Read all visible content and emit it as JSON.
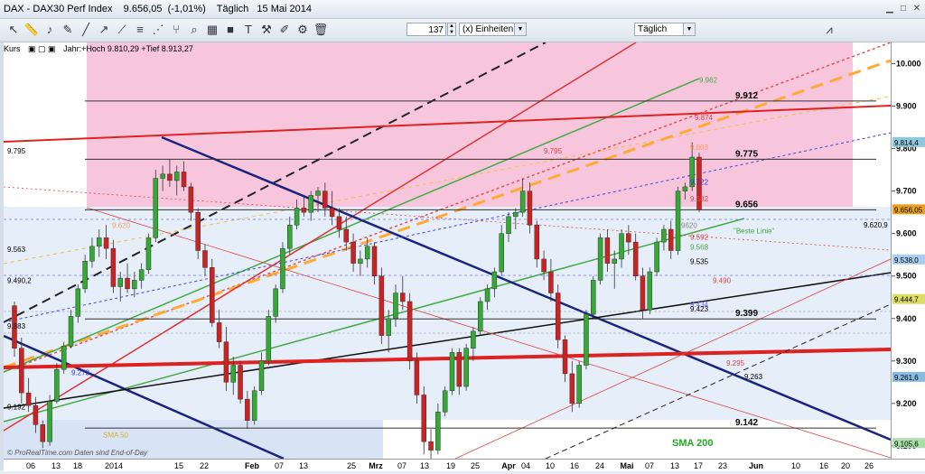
{
  "window": {
    "title": "DAX - DAX30 Perf Index    9.656,05  (-1,01%)    Täglich   15 Mai 2014"
  },
  "toolbar": {
    "icons": [
      "cursor-icon",
      "ruler-icon",
      "bell-icon",
      "pencil-icon",
      "line-icon",
      "ray-icon",
      "trend-icon",
      "fibonacci-icon",
      "gann-icon",
      "pitchfork-icon",
      "search-icon",
      "grid-icon",
      "square-icon",
      "rectangle-icon",
      "ellipse-icon",
      "arrow-icon",
      "marker-icon",
      "text-icon",
      "tools-icon",
      "hammer-icon",
      "brush-icon",
      "trash-icon"
    ],
    "bars_value": "137",
    "unit_select": "(x) Einheiten",
    "interval_select": "Täglich"
  },
  "panel": {
    "label": "Kurs",
    "info": "Jahr:+Hoch 9.810,29 +Tief 8.913,27"
  },
  "watermark": "© ProRealTime.com  Daten sind End-of-Day",
  "colors": {
    "up": "#33aa33",
    "down": "#cc2222",
    "pink_zone": "#f7c6dd",
    "blue_zone": "#dde8f8",
    "title_up": "#000000"
  },
  "right_axis": {
    "ticks": [
      "10.000",
      "9.900",
      "9.800",
      "9.700",
      "9.600",
      "9.500",
      "9.400",
      "9.300",
      "9.200",
      "9.100"
    ],
    "badges": [
      {
        "text": "9.814,4",
        "color": "#8fc8dc"
      },
      {
        "text": "9.656,05",
        "color": "#e8a020"
      },
      {
        "text": "9.538,0",
        "color": "#aaccee"
      },
      {
        "text": "9.444,7",
        "color": "#dddd66"
      },
      {
        "text": "9.261,6",
        "color": "#88bbdd"
      },
      {
        "text": "9.105,6",
        "color": "#aaddaa"
      }
    ]
  },
  "x_axis": {
    "ticks": [
      "06",
      "13",
      "18",
      "2014",
      "15",
      "22",
      "Feb",
      "07",
      "13",
      "25",
      "Mrz",
      "07",
      "13",
      "19",
      "25",
      "Apr",
      "04",
      "10",
      "16",
      "24",
      "Mai",
      "07",
      "13",
      "17",
      "23",
      "Jun",
      "10",
      "16",
      "20",
      "26"
    ]
  },
  "chart_data": {
    "type": "bar",
    "subtype": "candlestick",
    "title": "DAX - DAX30 Perf Index",
    "interval": "Täglich",
    "ylim": [
      9070,
      10050
    ],
    "candles": [
      [
        9430,
        9440,
        9310,
        9330
      ],
      [
        9330,
        9355,
        9200,
        9225
      ],
      [
        9225,
        9260,
        9180,
        9195
      ],
      [
        9195,
        9215,
        9130,
        9150
      ],
      [
        9150,
        9160,
        9095,
        9110
      ],
      [
        9110,
        9220,
        9100,
        9205
      ],
      [
        9205,
        9295,
        9200,
        9280
      ],
      [
        9280,
        9345,
        9270,
        9335
      ],
      [
        9335,
        9420,
        9330,
        9405
      ],
      [
        9405,
        9480,
        9390,
        9470
      ],
      [
        9470,
        9550,
        9460,
        9535
      ],
      [
        9535,
        9590,
        9520,
        9570
      ],
      [
        9570,
        9610,
        9545,
        9590
      ],
      [
        9590,
        9620,
        9540,
        9565
      ],
      [
        9565,
        9585,
        9460,
        9475
      ],
      [
        9475,
        9510,
        9440,
        9495
      ],
      [
        9495,
        9530,
        9460,
        9470
      ],
      [
        9470,
        9510,
        9450,
        9490
      ],
      [
        9490,
        9530,
        9470,
        9515
      ],
      [
        9515,
        9600,
        9505,
        9590
      ],
      [
        9590,
        9750,
        9580,
        9730
      ],
      [
        9730,
        9760,
        9700,
        9740
      ],
      [
        9740,
        9775,
        9710,
        9725
      ],
      [
        9725,
        9760,
        9690,
        9745
      ],
      [
        9745,
        9770,
        9700,
        9710
      ],
      [
        9710,
        9720,
        9630,
        9650
      ],
      [
        9650,
        9660,
        9540,
        9560
      ],
      [
        9560,
        9575,
        9500,
        9520
      ],
      [
        9520,
        9540,
        9380,
        9390
      ],
      [
        9390,
        9420,
        9330,
        9345
      ],
      [
        9345,
        9380,
        9230,
        9250
      ],
      [
        9250,
        9310,
        9220,
        9290
      ],
      [
        9290,
        9300,
        9200,
        9210
      ],
      [
        9210,
        9230,
        9140,
        9160
      ],
      [
        9160,
        9240,
        9150,
        9230
      ],
      [
        9230,
        9320,
        9220,
        9300
      ],
      [
        9300,
        9420,
        9290,
        9405
      ],
      [
        9405,
        9480,
        9390,
        9470
      ],
      [
        9470,
        9580,
        9460,
        9565
      ],
      [
        9565,
        9640,
        9550,
        9620
      ],
      [
        9620,
        9680,
        9610,
        9660
      ],
      [
        9660,
        9690,
        9640,
        9650
      ],
      [
        9650,
        9700,
        9630,
        9690
      ],
      [
        9690,
        9710,
        9650,
        9700
      ],
      [
        9700,
        9720,
        9640,
        9660
      ],
      [
        9660,
        9700,
        9620,
        9640
      ],
      [
        9640,
        9660,
        9590,
        9610
      ],
      [
        9610,
        9640,
        9560,
        9580
      ],
      [
        9580,
        9600,
        9510,
        9530
      ],
      [
        9530,
        9560,
        9500,
        9540
      ],
      [
        9540,
        9590,
        9520,
        9570
      ],
      [
        9570,
        9580,
        9480,
        9500
      ],
      [
        9500,
        9520,
        9340,
        9360
      ],
      [
        9360,
        9420,
        9320,
        9400
      ],
      [
        9400,
        9480,
        9380,
        9460
      ],
      [
        9460,
        9500,
        9420,
        9440
      ],
      [
        9440,
        9460,
        9280,
        9300
      ],
      [
        9300,
        9320,
        9200,
        9220
      ],
      [
        9220,
        9240,
        9080,
        9110
      ],
      [
        9110,
        9140,
        9070,
        9090
      ],
      [
        9090,
        9200,
        9080,
        9180
      ],
      [
        9180,
        9240,
        9170,
        9230
      ],
      [
        9230,
        9330,
        9220,
        9320
      ],
      [
        9320,
        9330,
        9220,
        9240
      ],
      [
        9240,
        9340,
        9230,
        9330
      ],
      [
        9330,
        9380,
        9300,
        9370
      ],
      [
        9370,
        9450,
        9360,
        9440
      ],
      [
        9440,
        9480,
        9420,
        9470
      ],
      [
        9470,
        9520,
        9450,
        9510
      ],
      [
        9510,
        9620,
        9500,
        9600
      ],
      [
        9600,
        9650,
        9580,
        9640
      ],
      [
        9640,
        9660,
        9610,
        9650
      ],
      [
        9650,
        9730,
        9640,
        9700
      ],
      [
        9700,
        9720,
        9600,
        9620
      ],
      [
        9620,
        9630,
        9520,
        9540
      ],
      [
        9540,
        9560,
        9490,
        9510
      ],
      [
        9510,
        9540,
        9440,
        9460
      ],
      [
        9460,
        9480,
        9330,
        9350
      ],
      [
        9350,
        9360,
        9250,
        9270
      ],
      [
        9270,
        9300,
        9180,
        9200
      ],
      [
        9200,
        9300,
        9190,
        9290
      ],
      [
        9290,
        9420,
        9280,
        9410
      ],
      [
        9410,
        9500,
        9400,
        9490
      ],
      [
        9490,
        9600,
        9480,
        9590
      ],
      [
        9590,
        9610,
        9510,
        9530
      ],
      [
        9530,
        9560,
        9470,
        9540
      ],
      [
        9540,
        9610,
        9520,
        9600
      ],
      [
        9600,
        9620,
        9550,
        9580
      ],
      [
        9580,
        9600,
        9490,
        9500
      ],
      [
        9500,
        9520,
        9400,
        9420
      ],
      [
        9420,
        9520,
        9410,
        9510
      ],
      [
        9510,
        9590,
        9500,
        9580
      ],
      [
        9580,
        9620,
        9560,
        9610
      ],
      [
        9610,
        9630,
        9540,
        9560
      ],
      [
        9560,
        9710,
        9550,
        9700
      ],
      [
        9700,
        9720,
        9680,
        9710
      ],
      [
        9710,
        9815,
        9700,
        9780
      ],
      [
        9780,
        9790,
        9650,
        9656
      ]
    ],
    "levels": [
      {
        "value": 9912,
        "label": "9.912"
      },
      {
        "value": 9775,
        "label": "9.775"
      },
      {
        "value": 9656,
        "label": "9.656"
      },
      {
        "value": 9399,
        "label": "9.399"
      },
      {
        "value": 9142,
        "label": "9.142"
      }
    ],
    "small_labels": [
      {
        "text": "9.962",
        "color": "#44aa44"
      },
      {
        "text": "9.874",
        "color": "#dd4444"
      },
      {
        "text": "9.803",
        "color": "#ff9966"
      },
      {
        "text": "9.795",
        "color": "#dd4444"
      },
      {
        "text": "9.722",
        "color": "#3333cc"
      },
      {
        "text": "9.682",
        "color": "#dd4444"
      },
      {
        "text": "9620",
        "color": "#888888"
      },
      {
        "text": "9.620,9",
        "color": "#000000"
      },
      {
        "text": "9.592",
        "color": "#dd4444"
      },
      {
        "text": "9.568",
        "color": "#44aa44"
      },
      {
        "text": "9.535",
        "color": "#000000"
      },
      {
        "text": "9.490",
        "color": "#dd4444"
      },
      {
        "text": "9.434",
        "color": "#6666ee"
      },
      {
        "text": "9.423",
        "color": "#000000"
      },
      {
        "text": "9.295",
        "color": "#dd4444"
      },
      {
        "text": "9.263",
        "color": "#000000"
      },
      {
        "text": "9.795",
        "color": "#000000"
      },
      {
        "text": "9.563",
        "color": "#000000"
      },
      {
        "text": "9.490,2",
        "color": "#000000"
      },
      {
        "text": "9.383",
        "color": "#000000"
      },
      {
        "text": "9.273",
        "color": "#3333cc"
      },
      {
        "text": "9.192",
        "color": "#000000"
      },
      {
        "text": "9.620",
        "color": "#ff9966"
      }
    ],
    "annotations": [
      "\"Beste Linie\"",
      "SMA 50",
      "SMA 200"
    ]
  }
}
